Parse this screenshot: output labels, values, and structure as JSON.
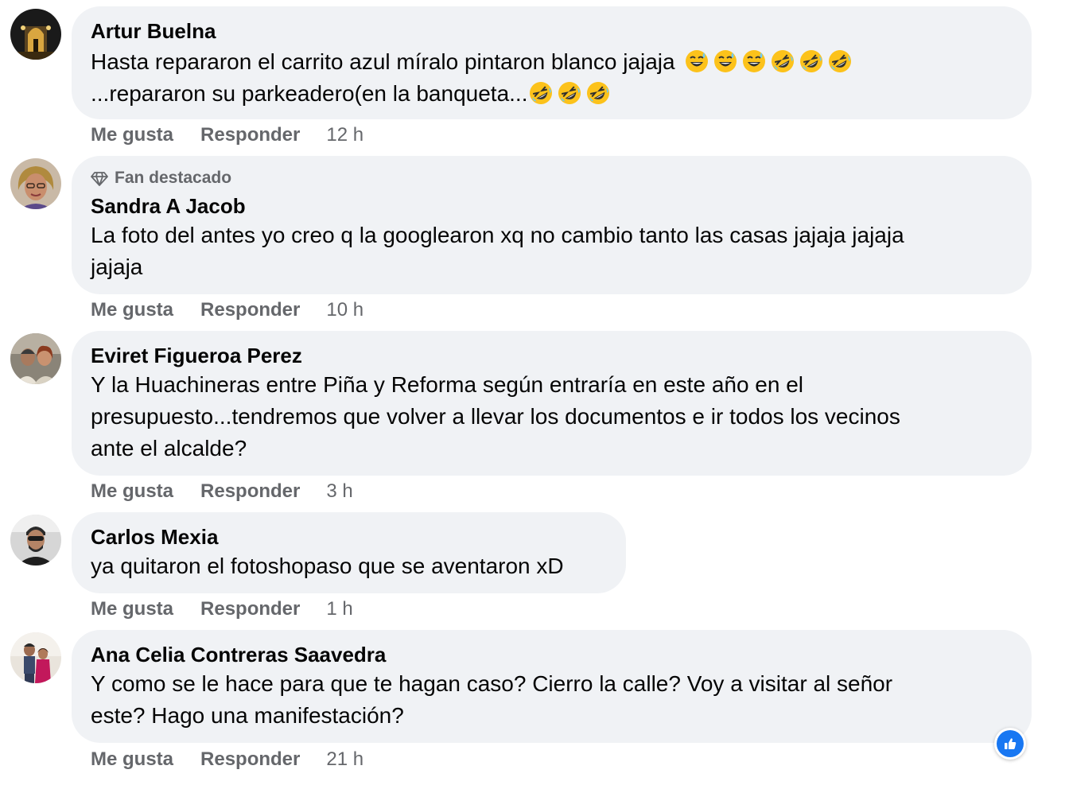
{
  "comments": [
    {
      "author": "Artur Buelna",
      "badge": "",
      "text_line1": "Hasta repararon el carrito azul míralo pintaron blanco jajaja",
      "text_line2": "...repararon su parkeadero(en la banqueta...",
      "emojis_line1": [
        "grinning-sweat",
        "grinning-sweat",
        "grinning-sweat",
        "rofl",
        "rofl",
        "rofl"
      ],
      "emojis_line2": [
        "rofl",
        "rofl",
        "rofl"
      ],
      "like_label": "Me gusta",
      "reply_label": "Responder",
      "time": "12 h"
    },
    {
      "author": "Sandra A Jacob",
      "badge": "Fan destacado",
      "text": "La foto del antes yo creo q la googlearon xq no cambio tanto las casas jajaja jajaja\njajaja",
      "like_label": "Me gusta",
      "reply_label": "Responder",
      "time": "10 h"
    },
    {
      "author": "Eviret Figueroa Perez",
      "badge": "",
      "text": "Y la Huachineras entre Piña y Reforma según entraría en este año en el\npresupuesto...tendremos que volver a llevar los documentos e ir todos los vecinos\nante el alcalde?",
      "like_label": "Me gusta",
      "reply_label": "Responder",
      "time": "3 h"
    },
    {
      "author": "Carlos Mexia",
      "badge": "",
      "text": "ya quitaron el fotoshopaso que se aventaron xD",
      "like_label": "Me gusta",
      "reply_label": "Responder",
      "time": "1 h"
    },
    {
      "author": "Ana Celia Contreras Saavedra",
      "badge": "",
      "text": "Y como se le hace para que te hagan caso? Cierro la calle? Voy a visitar al señor\neste? Hago una manifestación?",
      "like_label": "Me gusta",
      "reply_label": "Responder",
      "time": "21 h"
    }
  ],
  "reaction_icon": "like-thumb-icon",
  "colors": {
    "bubble": "#f0f2f5",
    "secondary_text": "#65676b",
    "like_blue": "#1877f2"
  }
}
